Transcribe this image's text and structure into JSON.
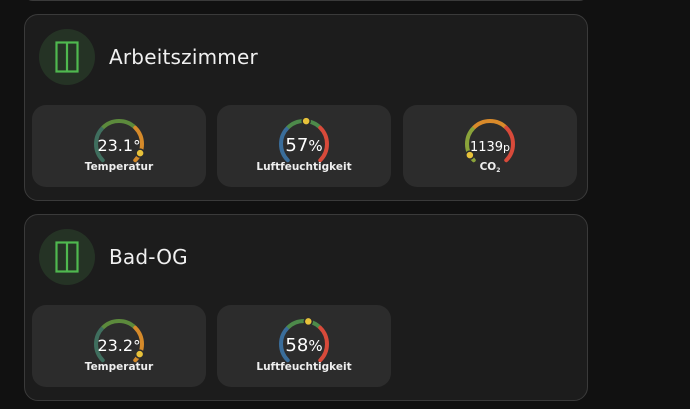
{
  "rooms": [
    {
      "name": "Arbeitszimmer",
      "sensors": [
        {
          "value": "23.1",
          "unit": "°",
          "label": "Temperatur",
          "fraction": 0.92,
          "value_size": 16
        },
        {
          "value": "57",
          "unit": "%",
          "label": "Luftfeuchtigkeit",
          "fraction": 0.52,
          "value_size": 18
        },
        {
          "value": "1139",
          "unit": "p",
          "label": "CO",
          "label_sub": "2",
          "fraction": 0.06,
          "value_size": 13
        }
      ]
    },
    {
      "name": "Bad-OG",
      "sensors": [
        {
          "value": "23.2",
          "unit": "°",
          "label": "Temperatur",
          "fraction": 0.93,
          "value_size": 16
        },
        {
          "value": "58",
          "unit": "%",
          "label": "Luftfeuchtigkeit",
          "fraction": 0.54,
          "value_size": 18
        }
      ]
    }
  ],
  "gauge_styles": {
    "Temperatur": [
      "#3f6e5e",
      "#5c8a3c",
      "#d58a2a"
    ],
    "Luftfeuchtigkeit": [
      "#3a6d9a",
      "#4d8a4a",
      "#d84a3a"
    ],
    "CO": [
      "#8aa33a",
      "#d98a2a",
      "#d84a3a"
    ]
  },
  "icon_color": "#4fb84f",
  "icon": "window-icon",
  "marker_color": "#e8c23a"
}
